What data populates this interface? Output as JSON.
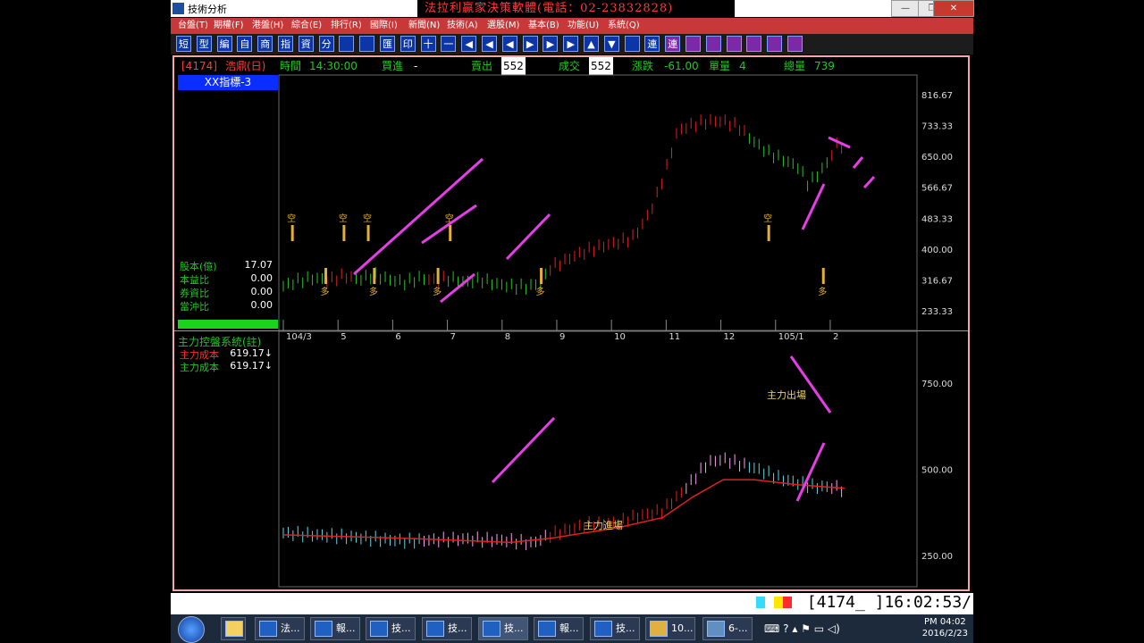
{
  "window": {
    "title": "技術分析",
    "banner": "法拉利贏家決策軟體(電話：02-23832828)",
    "controls": [
      "—",
      "❐",
      "✕"
    ]
  },
  "menu": [
    "台盤(T)",
    "期權(F)",
    "港盤(H)",
    "綜合(E)",
    "排行(R)",
    "國際(I)",
    "新聞(N)",
    "技術(A)",
    "選股(M)",
    "基本(B)",
    "功能(U)",
    "系統(Q)"
  ],
  "toolbar": [
    "短",
    "型",
    "編",
    "自",
    "商",
    "指",
    "資",
    "分",
    "",
    "",
    "匯",
    "印",
    "十",
    "一",
    "◀",
    "◀",
    "◀",
    "▶",
    "▶",
    "▶",
    "▲",
    "▼",
    "",
    "連",
    "連",
    "",
    "",
    "",
    "",
    "",
    ""
  ],
  "info": {
    "code": "[4174]",
    "name": "浩鼎(日)",
    "time_label": "時間",
    "time": "14:30:00",
    "bid_label": "買進",
    "bid": "-",
    "ask_label": "賣出",
    "ask": "552",
    "deal_label": "成交",
    "deal": "552",
    "chg_label": "漲跌",
    "chg": "-61.00",
    "vol_label": "單量",
    "vol": "4",
    "total_label": "總量",
    "total": "739"
  },
  "upper": {
    "tab": "XX指標-3",
    "stats": [
      {
        "label": "股本(億)",
        "value": "17.07"
      },
      {
        "label": "本益比",
        "value": "0.00"
      },
      {
        "label": "券資比",
        "value": "0.00"
      },
      {
        "label": "當沖比",
        "value": "0.00"
      }
    ]
  },
  "lower": {
    "title": "主力控盤系統(註)",
    "rows": [
      {
        "label": "主力成本",
        "value": "619.17↓",
        "color": "#ff3030"
      },
      {
        "label": "主力成本",
        "value": "619.17↓",
        "color": "#27c327"
      }
    ],
    "ann_in": "主力進場",
    "ann_out": "主力出場"
  },
  "signals": {
    "short": "空",
    "long": "多"
  },
  "status": {
    "clock": "[4174_ ]16:02:53/"
  },
  "taskbar": {
    "tasks": [
      "法...",
      "報...",
      "技...",
      "技...",
      "技...",
      "報...",
      "技...",
      "10...",
      "6-..."
    ],
    "time": "PM 04:02",
    "date": "2016/2/23"
  },
  "chart_data": [
    {
      "type": "candlestick",
      "title": "XX指標-3",
      "x_labels": [
        "104/3",
        "5",
        "6",
        "7",
        "8",
        "9",
        "10",
        "11",
        "12",
        "105/1",
        "2"
      ],
      "y_ticks": [
        "816.67",
        "733.33",
        "650.00",
        "566.67",
        "483.33",
        "400.00",
        "316.67",
        "233.33"
      ],
      "ylim": [
        200,
        850
      ],
      "series": [
        {
          "values": [
            [
              0,
              300
            ],
            [
              5,
              315
            ],
            [
              10,
              322
            ],
            [
              15,
              316
            ],
            [
              20,
              328
            ],
            [
              25,
              318
            ],
            [
              30,
              330
            ],
            [
              35,
              318
            ],
            [
              40,
              310
            ],
            [
              45,
              322
            ],
            [
              50,
              316
            ],
            [
              55,
              322
            ],
            [
              60,
              310
            ],
            [
              65,
              318
            ],
            [
              70,
              306
            ],
            [
              75,
              300
            ],
            [
              80,
              298
            ],
            [
              85,
              308
            ],
            [
              88,
              350
            ],
            [
              92,
              365
            ],
            [
              96,
              382
            ],
            [
              100,
              395
            ],
            [
              105,
              408
            ],
            [
              110,
              418
            ],
            [
              115,
              430
            ],
            [
              118,
              460
            ],
            [
              122,
              520
            ],
            [
              126,
              610
            ],
            [
              130,
              720
            ],
            [
              135,
              735
            ],
            [
              140,
              745
            ],
            [
              145,
              745
            ],
            [
              150,
              730
            ],
            [
              155,
              690
            ],
            [
              160,
              660
            ],
            [
              165,
              640
            ],
            [
              170,
              620
            ],
            [
              173,
              575
            ],
            [
              176,
              600
            ],
            [
              180,
              640
            ],
            [
              182,
              680
            ]
          ]
        }
      ],
      "signals": [
        {
          "x": 3,
          "type": "空"
        },
        {
          "x": 20,
          "type": "空"
        },
        {
          "x": 28,
          "type": "空"
        },
        {
          "x": 55,
          "type": "空"
        },
        {
          "x": 14,
          "type": "多"
        },
        {
          "x": 30,
          "type": "多"
        },
        {
          "x": 51,
          "type": "多"
        },
        {
          "x": 85,
          "type": "多"
        },
        {
          "x": 160,
          "type": "空"
        },
        {
          "x": 178,
          "type": "多"
        }
      ]
    },
    {
      "type": "candlestick",
      "title": "主力控盤系統(註)",
      "y_ticks": [
        "750.00",
        "500.00",
        "250.00"
      ],
      "ylim": [
        180,
        880
      ],
      "series": [
        {
          "name": "主力成本",
          "values": [
            [
              0,
              315
            ],
            [
              20,
              305
            ],
            [
              40,
              292
            ],
            [
              60,
              298
            ],
            [
              75,
              293
            ],
            [
              82,
              285
            ],
            [
              88,
              310
            ],
            [
              100,
              340
            ],
            [
              110,
              345
            ],
            [
              115,
              360
            ],
            [
              125,
              380
            ],
            [
              132,
              440
            ],
            [
              140,
              520
            ],
            [
              145,
              530
            ],
            [
              155,
              505
            ],
            [
              165,
              470
            ],
            [
              175,
              450
            ],
            [
              182,
              448
            ],
            [
              185,
              440
            ]
          ]
        }
      ]
    }
  ]
}
